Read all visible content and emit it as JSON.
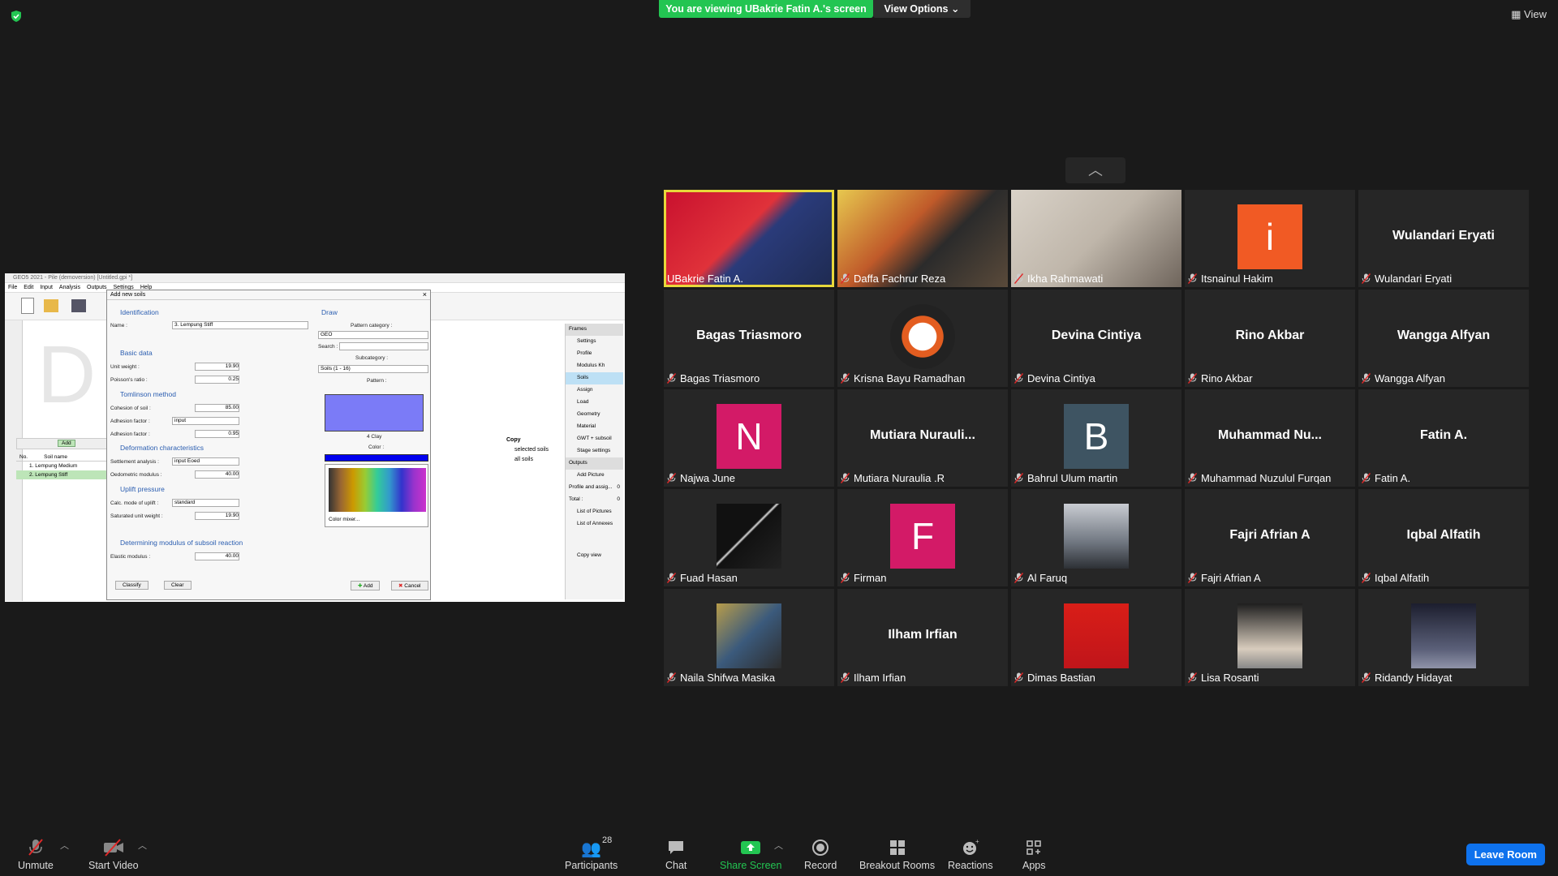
{
  "top": {
    "banner": "You are viewing UBakrie Fatin A.'s screen",
    "view_options": "View Options",
    "view_button": "View"
  },
  "colors": {
    "banner": "#23c552",
    "leave": "#0e72ed",
    "speaker_highlight": "#e7d83b"
  },
  "participants": [
    {
      "label": "UBakrie Fatin A.",
      "display": "video",
      "muted": false
    },
    {
      "label": "Daffa Fachrur Reza",
      "display": "video",
      "muted": true
    },
    {
      "label": "Ikha Rahmawati",
      "display": "video",
      "muted": true
    },
    {
      "label": "Itsnainul Hakim",
      "display": "avatar",
      "avatar": "i",
      "color": "#f15a24",
      "muted": true
    },
    {
      "label": "Wulandari Eryati",
      "display": "name",
      "name": "Wulandari Eryati",
      "muted": true
    },
    {
      "label": "Bagas Triasmoro",
      "display": "name",
      "name": "Bagas Triasmoro",
      "muted": true
    },
    {
      "label": "Krisna Bayu Ramadhan",
      "display": "picture",
      "muted": true
    },
    {
      "label": "Devina Cintiya",
      "display": "name",
      "name": "Devina Cintiya",
      "muted": true
    },
    {
      "label": "Rino Akbar",
      "display": "name",
      "name": "Rino Akbar",
      "muted": true
    },
    {
      "label": "Wangga Alfyan",
      "display": "name",
      "name": "Wangga Alfyan",
      "muted": true
    },
    {
      "label": "Najwa June",
      "display": "avatar",
      "avatar": "N",
      "color": "#d31a67",
      "muted": true
    },
    {
      "label": "Mutiara Nuraulia .R",
      "display": "name",
      "name": "Mutiara  Nurauli...",
      "muted": true
    },
    {
      "label": "Bahrul Ulum martin",
      "display": "avatar",
      "avatar": "B",
      "color": "#3e5462",
      "muted": true
    },
    {
      "label": "Muhammad Nuzulul Furqan",
      "display": "name",
      "name": "Muhammad  Nu...",
      "muted": true
    },
    {
      "label": "Fatin A.",
      "display": "name",
      "name": "Fatin A.",
      "muted": true
    },
    {
      "label": "Fuad Hasan",
      "display": "picture",
      "muted": true
    },
    {
      "label": "Firman",
      "display": "avatar",
      "avatar": "F",
      "color": "#d31a67",
      "muted": true
    },
    {
      "label": "Al Faruq",
      "display": "picture",
      "muted": true
    },
    {
      "label": "Fajri Afrian A",
      "display": "name",
      "name": "Fajri Afrian A",
      "muted": true
    },
    {
      "label": "Iqbal Alfatih",
      "display": "name",
      "name": "Iqbal Alfatih",
      "muted": true
    },
    {
      "label": "Naila Shifwa Masika",
      "display": "picture",
      "muted": true
    },
    {
      "label": "Ilham Irfian",
      "display": "name",
      "name": "Ilham Irfian",
      "muted": true
    },
    {
      "label": "Dimas Bastian",
      "display": "picture",
      "muted": true
    },
    {
      "label": "Lisa Rosanti",
      "display": "picture",
      "muted": true
    },
    {
      "label": "Ridandy Hidayat",
      "display": "picture",
      "muted": true
    }
  ],
  "toolbar": {
    "unmute": "Unmute",
    "start_video": "Start Video",
    "participants": "Participants",
    "participants_count": "28",
    "chat": "Chat",
    "share_screen": "Share Screen",
    "record": "Record",
    "breakout_rooms": "Breakout Rooms",
    "reactions": "Reactions",
    "apps": "Apps",
    "leave": "Leave Room"
  },
  "geos": {
    "title": "GEO5 2021 - Pile (demoversion) [Untitled.gpi *]",
    "menu": [
      "File",
      "Edit",
      "Input",
      "Analysis",
      "Outputs",
      "Settings",
      "Help"
    ],
    "dialog_title": "Add new soils",
    "identification": "Identification",
    "name_label": "Name :",
    "name_value": "3. Lempung Stiff",
    "basic_data": "Basic data",
    "unit_weight": "Unit weight :",
    "unit_weight_val": "19.90",
    "poisson": "Poisson's ratio :",
    "poisson_val": "0.25",
    "tomlinson": "Tomlinson method",
    "cohesion": "Cohesion of soil :",
    "cohesion_val": "85.00",
    "adhesion_factor": "Adhesion factor :",
    "adhesion_factor_val": "input",
    "adhesion_factor2": "Adhesion factor :",
    "adhesion_alpha": "0.95",
    "deformation": "Deformation characteristics",
    "settlement": "Settlement analysis :",
    "settlement_val": "input Eoed",
    "oedometric": "Oedometric modulus :",
    "oedometric_val": "40.00",
    "uplift": "Uplift pressure",
    "uplift_mode": "Calc. mode of uplift :",
    "uplift_mode_val": "standard",
    "saturated": "Saturated unit weight :",
    "saturated_val": "19.90",
    "subsoil": "Determining modulus of subsoil reaction",
    "elastic": "Elastic modulus :",
    "elastic_val": "40.00",
    "draw": "Draw",
    "pattern_category": "Pattern category :",
    "pattern_category_val": "GEO",
    "search": "Search :",
    "subcategory": "Subcategory :",
    "subcategory_val": "Soils (1 - 16)",
    "pattern": "Pattern :",
    "pattern_name": "4 Clay",
    "color": "Color :",
    "color_mixer": "Color mixer...",
    "classify": "Classify",
    "clear": "Clear",
    "add": "Add",
    "cancel": "Cancel",
    "soil_header_no": "No.",
    "soil_header_name": "Soil name",
    "soils": [
      "1. Lempung Medium",
      "2. Lempung Stiff"
    ],
    "add_button": "Add",
    "copy": "Copy",
    "selected_soils": "selected soils",
    "all_soils": "all soils",
    "frames": "Frames",
    "frame_items": [
      "Settings",
      "Profile",
      "Modulus Kh",
      "Soils",
      "Assign",
      "Load",
      "Geometry",
      "Material",
      "GWT + subsoil",
      "Stage settings"
    ],
    "outputs": "Outputs",
    "add_picture": "Add Picture",
    "profile_assign": "Profile and assig...",
    "profile_assign_val": "0",
    "total": "Total :",
    "total_val": "0",
    "list_pictures": "List of Pictures",
    "list_annexes": "List of Annexes",
    "copy_view": "Copy view",
    "watermark": "D                     ion"
  }
}
